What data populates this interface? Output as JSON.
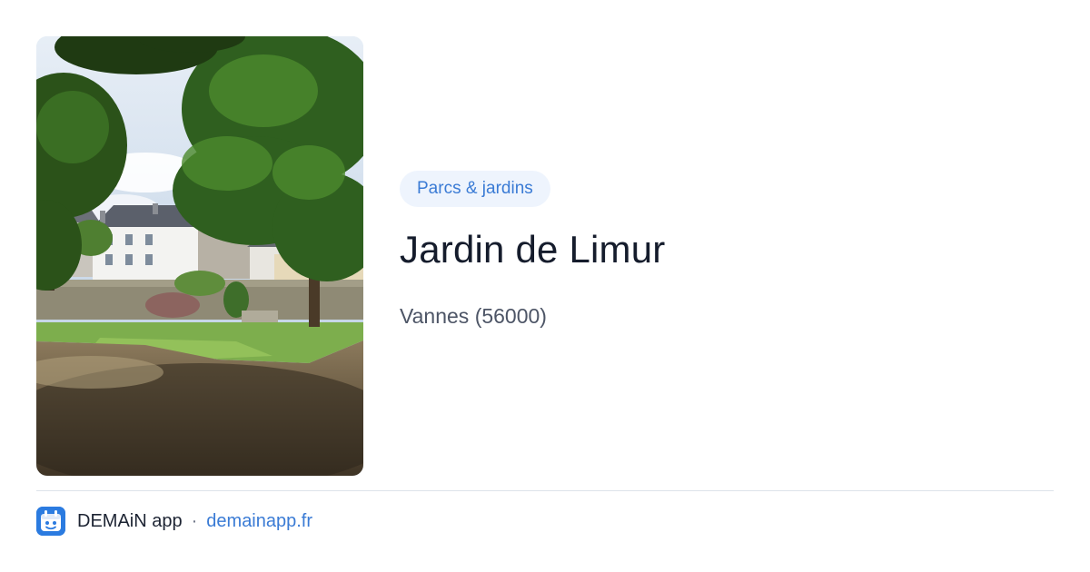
{
  "place": {
    "category": "Parcs & jardins",
    "name": "Jardin de Limur",
    "location": "Vannes (56000)"
  },
  "footer": {
    "app_name": "DEMAiN app",
    "separator": "·",
    "url": "demainapp.fr"
  },
  "colors": {
    "accent": "#3a7bd5",
    "tag_background": "#eef4fd",
    "title": "#151c2c",
    "muted": "#4d5566",
    "divider": "#dde3ea"
  },
  "icons": {
    "app_icon": "demain-app-icon"
  }
}
